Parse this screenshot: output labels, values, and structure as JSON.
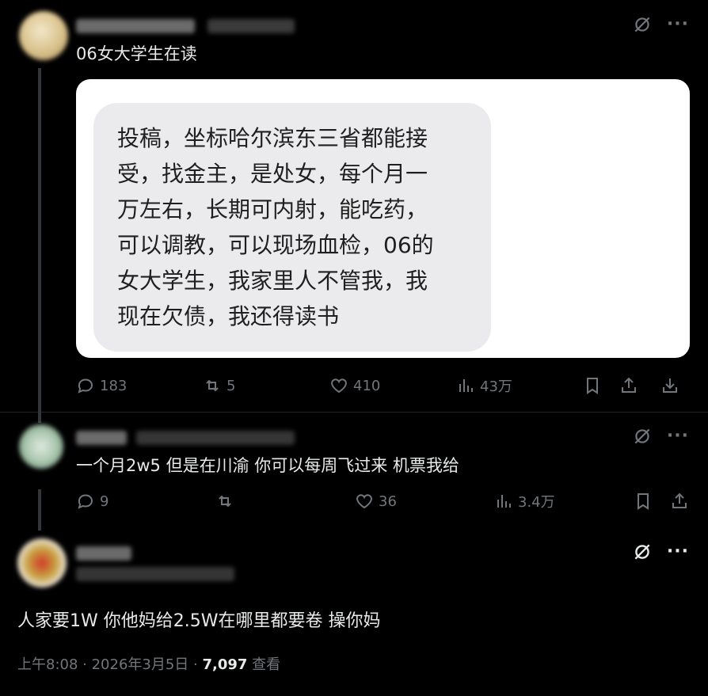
{
  "post1": {
    "bio": "06女大学生在读",
    "image_text": "投稿，坐标哈尔滨东三省都能接\n受，找金主，是处女，每个月一\n万左右，长期可内射，能吃药，\n可以调教，可以现场血检，06的\n女大学生，我家里人不管我，我\n现在欠债，我还得读书",
    "replies": "183",
    "reposts": "5",
    "likes": "410",
    "views": "43万"
  },
  "post2": {
    "text": "一个月2w5 但是在川渝 你可以每周飞过来 机票我给",
    "replies": "9",
    "reposts": "",
    "likes": "36",
    "views": "3.4万"
  },
  "post3": {
    "text": "人家要1W 你他妈给2.5W在哪里都要卷 操你妈",
    "time": "上午8:08 · 2026年3月5日 · ",
    "views_count": "7,097",
    "views_label": " 查看"
  },
  "icons": {
    "reply": "reply-icon",
    "repost": "repost-icon",
    "like": "heart-icon",
    "views": "views-icon",
    "bookmark": "bookmark-icon",
    "share": "share-icon",
    "download": "download-icon",
    "grok": "grok-icon",
    "more": "more-icon"
  },
  "colors": {
    "background": "#000000",
    "muted": "#71767b",
    "text": "#e7e9ea"
  }
}
